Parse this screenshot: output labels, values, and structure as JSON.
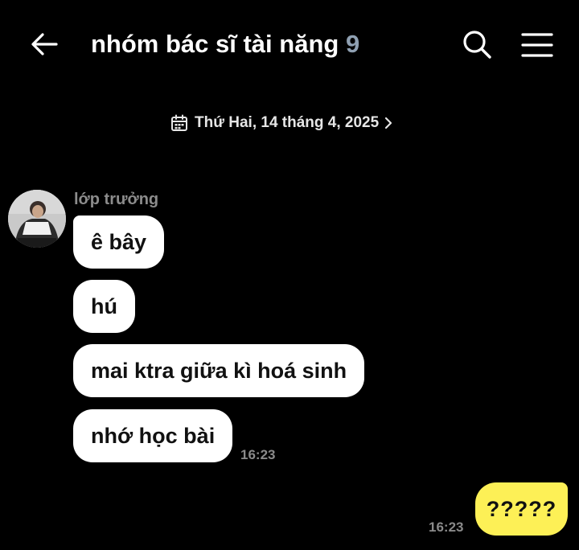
{
  "header": {
    "title": "nhóm bác sĩ tài năng",
    "member_count": "9",
    "back_icon": "arrow-left-icon",
    "search_icon": "search-icon",
    "menu_icon": "hamburger-menu-icon"
  },
  "date_divider": {
    "label": "Thứ Hai, 14 tháng 4, 2025",
    "icon": "calendar-icon",
    "chevron": "chevron-right-icon"
  },
  "messages": [
    {
      "sender": "lớp trưởng",
      "text": "ê bây"
    },
    {
      "text": "hú"
    },
    {
      "text": "mai ktra giữa kì hoá sinh"
    },
    {
      "text": "nhớ học bài",
      "time": "16:23"
    }
  ],
  "my_message": {
    "text": "?????",
    "time": "16:23"
  },
  "colors": {
    "background": "#000000",
    "incoming_bubble": "#ffffff",
    "outgoing_bubble": "#fdf056",
    "member_count": "#8fa0b2",
    "muted_text": "#8a8a8a"
  }
}
